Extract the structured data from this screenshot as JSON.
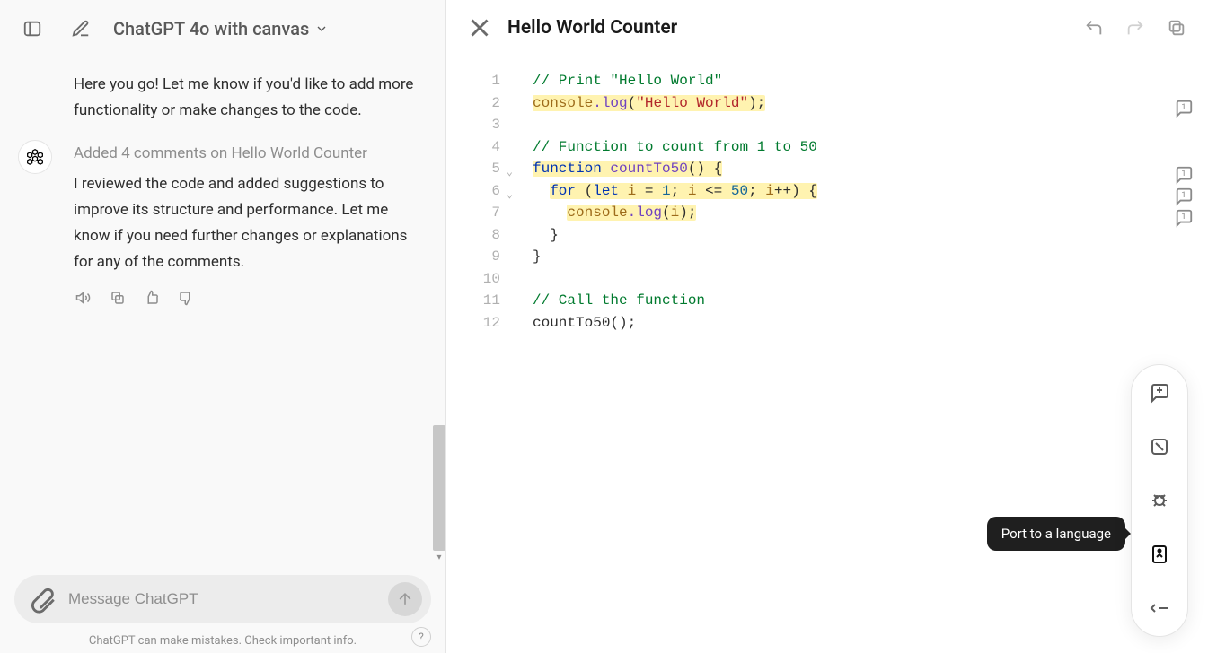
{
  "header": {
    "model_label": "ChatGPT 4o with canvas"
  },
  "chat": {
    "msg1": "Here you go! Let me know if you'd like to add more functionality or make changes to the code.",
    "comment_title": "Added 4 comments on Hello World Counter",
    "msg2": "I reviewed the code and added suggestions to improve its structure and performance. Let me know if you need further changes or explanations for any of the comments."
  },
  "composer": {
    "placeholder": "Message ChatGPT"
  },
  "disclaimer": "ChatGPT can make mistakes. Check important info.",
  "canvas": {
    "title": "Hello World Counter",
    "line_numbers": [
      "1",
      "2",
      "3",
      "4",
      "5",
      "6",
      "7",
      "8",
      "9",
      "10",
      "11",
      "12"
    ],
    "code": {
      "l1_comment": "// Print \"Hello World\"",
      "l2_console": "console",
      "l2_log": ".log",
      "l2_open": "(",
      "l2_str": "\"Hello World\"",
      "l2_close": ");",
      "l4_comment": "// Function to count from 1 to 50",
      "l5_kw": "function",
      "l5_name": " countTo50",
      "l5_rest": "() {",
      "l6_for": "for",
      "l6_open": " (",
      "l6_let": "let",
      "l6_var1": " i ",
      "l6_eq": "= ",
      "l6_n1": "1",
      "l6_semi1": "; ",
      "l6_var2": "i ",
      "l6_op": "<= ",
      "l6_n2": "50",
      "l6_semi2": "; ",
      "l6_var3": "i",
      "l6_inc": "++",
      "l6_close": ") {",
      "l7_indent": "    ",
      "l7_console": "console",
      "l7_log": ".log",
      "l7_open": "(",
      "l7_var": "i",
      "l7_close": ");",
      "l8": "  }",
      "l9": "}",
      "l11_comment": "// Call the function",
      "l12": "countTo50();"
    },
    "comment_badges": [
      "1",
      "1",
      "1",
      "1"
    ]
  },
  "tooltip": "Port to a language",
  "help_glyph": "?"
}
